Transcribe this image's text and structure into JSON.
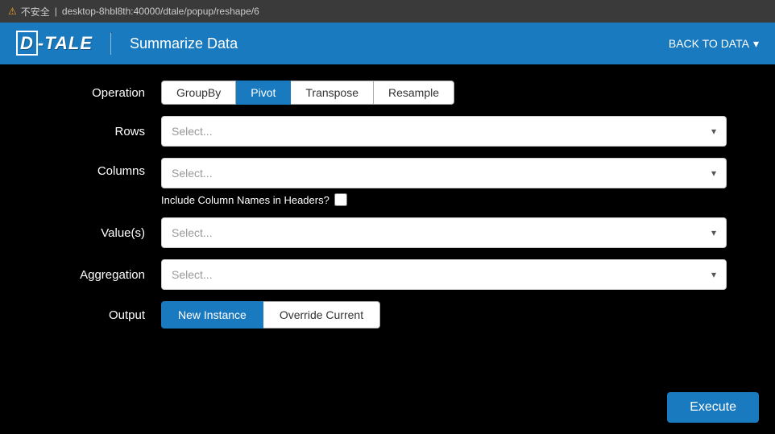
{
  "browser_bar": {
    "warning": "⚠",
    "security_text": "不安全",
    "url": "desktop-8hbl8th:40000/dtale/popup/reshape/6"
  },
  "header": {
    "logo": "D-TALE",
    "title": "Summarize Data",
    "back_button": "BACK TO DATA",
    "back_arrow": "▾"
  },
  "operation": {
    "label": "Operation",
    "buttons": [
      {
        "id": "groupby",
        "label": "GroupBy",
        "active": false
      },
      {
        "id": "pivot",
        "label": "Pivot",
        "active": true
      },
      {
        "id": "transpose",
        "label": "Transpose",
        "active": false
      },
      {
        "id": "resample",
        "label": "Resample",
        "active": false
      }
    ]
  },
  "rows": {
    "label": "Rows",
    "placeholder": "Select...",
    "arrow": "▾"
  },
  "columns": {
    "label": "Columns",
    "placeholder": "Select...",
    "arrow": "▾",
    "include_label": "Include Column Names in Headers?"
  },
  "values": {
    "label": "Value(s)",
    "placeholder": "Select...",
    "arrow": "▾"
  },
  "aggregation": {
    "label": "Aggregation",
    "placeholder": "Select...",
    "arrow": "▾"
  },
  "output": {
    "label": "Output",
    "buttons": [
      {
        "id": "new-instance",
        "label": "New Instance",
        "active": true
      },
      {
        "id": "override-current",
        "label": "Override Current",
        "active": false
      }
    ]
  },
  "execute": {
    "label": "Execute"
  }
}
